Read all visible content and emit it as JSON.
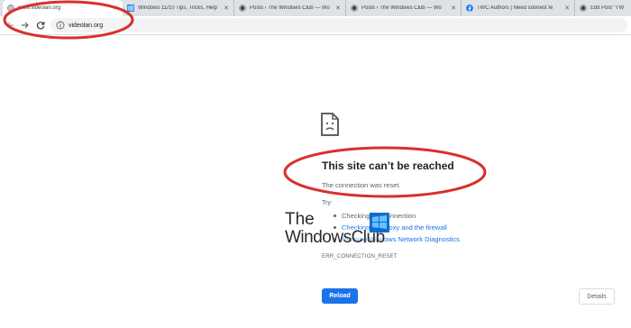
{
  "tabs": [
    {
      "title": "www.videolan.org",
      "active": true,
      "favicon": "globe-icon"
    },
    {
      "title": "Windows 11/10 Tips, Tricks, Help",
      "favicon": "windows-logo-icon"
    },
    {
      "title": "Posts ‹ The Windows Club — Wo",
      "favicon": "wordpress-icon"
    },
    {
      "title": "Posts ‹ The Windows Club — Wo",
      "favicon": "wordpress-icon"
    },
    {
      "title": "TWC Authors | Need soonest fe",
      "favicon": "facebook-icon"
    },
    {
      "title": "Edit Post \"TW",
      "favicon": "wordpress-icon"
    }
  ],
  "toolbar": {
    "url": "videolan.org"
  },
  "error": {
    "title": "This site can’t be reached",
    "subtitle": "The connection was reset.",
    "try_label": "Try:",
    "suggestions": [
      "Checking the connection",
      "Checking the proxy and the firewall",
      "Running Windows Network Diagnostics"
    ],
    "code": "ERR_CONNECTION_RESET",
    "reload_label": "Reload",
    "details_label": "Details"
  },
  "watermark": {
    "line1": "The",
    "line2": "WindowsClub"
  },
  "colors": {
    "annotation": "#d9302c",
    "link": "#1a73e8",
    "button": "#1a73e8"
  }
}
